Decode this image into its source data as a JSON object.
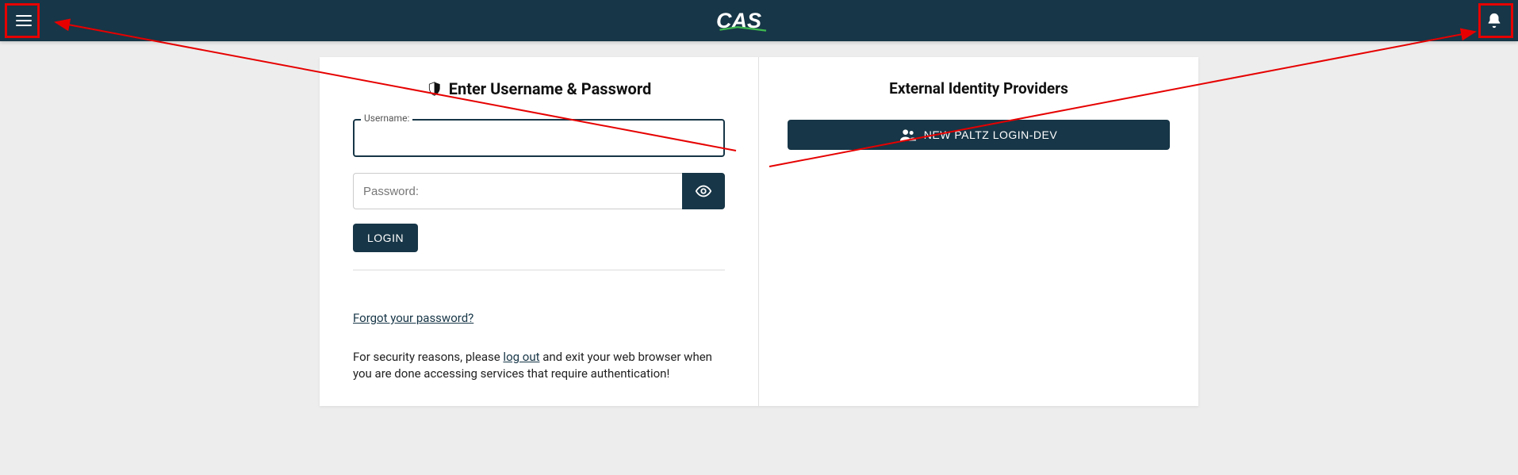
{
  "header": {
    "logo_text": "CAS"
  },
  "login": {
    "title": "Enter Username & Password",
    "username_label": "Username:",
    "username_value": "",
    "password_placeholder": "Password:",
    "password_value": "",
    "login_button": "LOGIN",
    "forgot_link": "Forgot your password?",
    "security_prefix": "For security reasons, please ",
    "security_logout": "log out",
    "security_suffix": " and exit your web browser when you are done accessing services that require authentication!"
  },
  "providers": {
    "title": "External Identity Providers",
    "button_label": "NEW PALTZ LOGIN-DEV"
  },
  "colors": {
    "primary": "#173647",
    "annotation": "#e60000"
  }
}
